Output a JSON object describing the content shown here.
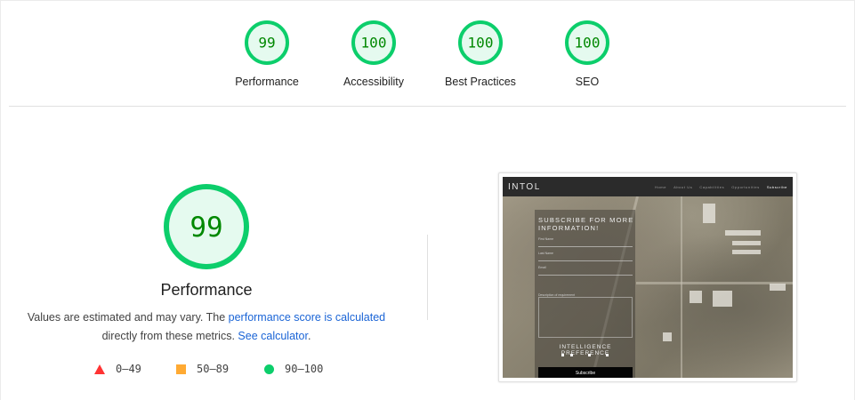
{
  "gauges": [
    {
      "score": "99",
      "label": "Performance",
      "value": 99
    },
    {
      "score": "100",
      "label": "Accessibility",
      "value": 100
    },
    {
      "score": "100",
      "label": "Best Practices",
      "value": 100
    },
    {
      "score": "100",
      "label": "SEO",
      "value": 100
    }
  ],
  "main": {
    "score": "99",
    "value": 99,
    "title": "Performance",
    "desc_prefix": "Values are estimated and may vary. The ",
    "link_score": "performance score is calculated",
    "desc_middle": " directly from these metrics. ",
    "link_calc": "See calculator",
    "desc_suffix": "."
  },
  "legend": [
    {
      "range": "0–49",
      "shape": "triangle",
      "color": "#ff3333"
    },
    {
      "range": "50–89",
      "shape": "square",
      "color": "#ffaa33"
    },
    {
      "range": "90–100",
      "shape": "circle",
      "color": "#0cce6b"
    }
  ],
  "colors": {
    "pass": "#0cce6b",
    "pass_text": "#008800",
    "pass_bg": "#e5faef",
    "link": "#1a64d6"
  },
  "thumbnail": {
    "logo": "INTOL",
    "nav": [
      "Home",
      "About Us",
      "Capabilities",
      "Opportunities",
      "Subscribe"
    ],
    "heading": "SUBSCRIBE FOR MORE INFORMATION!",
    "fields": [
      "First Name",
      "Last Name",
      "Email"
    ],
    "box_label": "Description of requirement",
    "pref": "INTELLIGENCE PREFERENCE",
    "button": "Subscribe"
  }
}
